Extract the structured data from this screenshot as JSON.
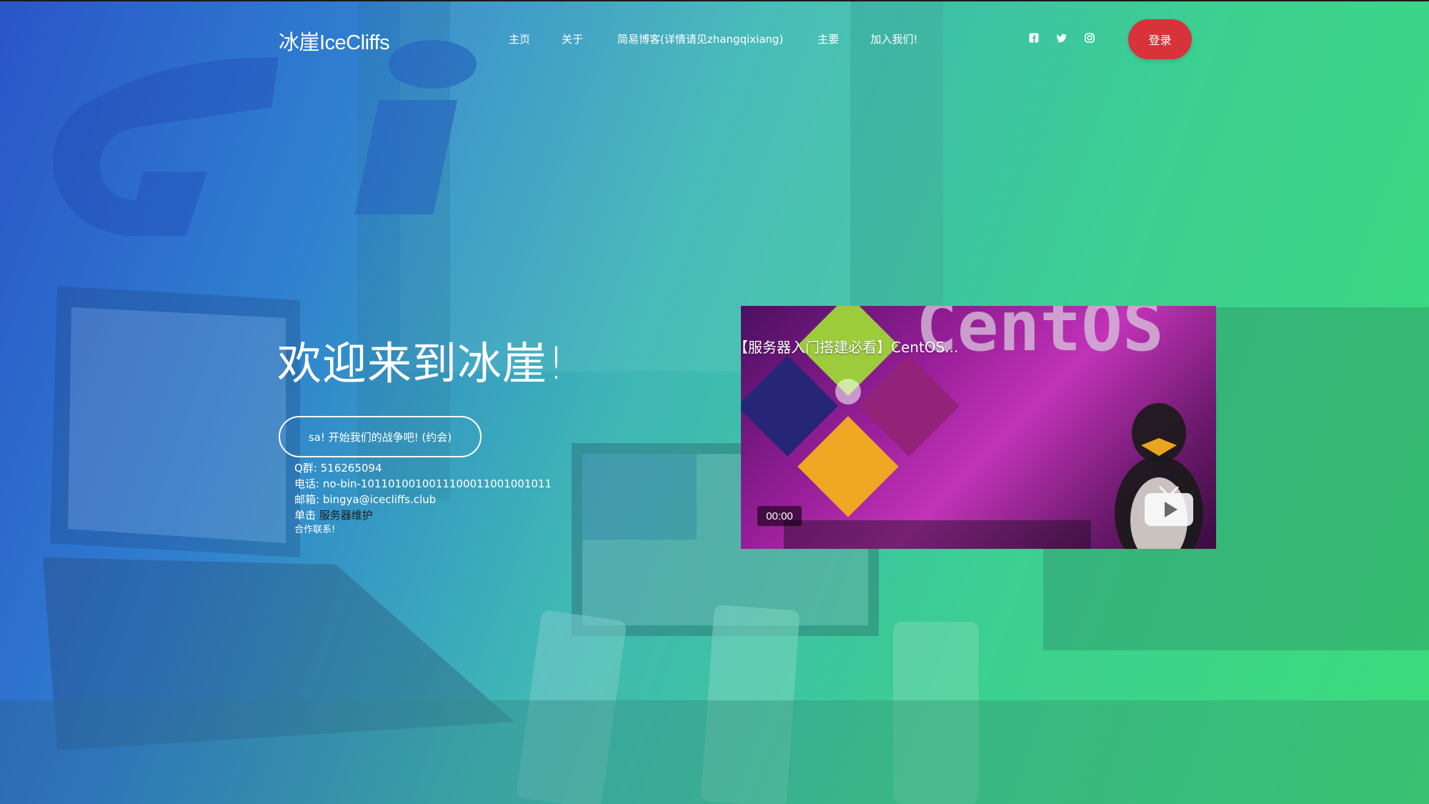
{
  "brand": {
    "name": "冰崖IceCliffs"
  },
  "nav": {
    "items": [
      {
        "label": "主页"
      },
      {
        "label": "关于"
      },
      {
        "label": "简易博客(详情请见zhangqixiang)"
      },
      {
        "label": "主要"
      },
      {
        "label": "加入我们!"
      }
    ],
    "socials": [
      {
        "icon": "facebook-icon"
      },
      {
        "icon": "twitter-icon"
      },
      {
        "icon": "instagram-icon"
      }
    ],
    "login_label": "登录"
  },
  "hero": {
    "title": "欢迎来到冰崖!",
    "cta_label": "sa! 开始我们的战争吧! (约会)",
    "contact": {
      "qq": "Q群: 516265094",
      "phone": "电话: no-bin-1011010010011100011001001011",
      "email": "邮箱: bingya@icecliffs.club",
      "maintenance_prefix": "单击 ",
      "maintenance_link": "服务器维护",
      "cooperation": "合作联系!"
    }
  },
  "video": {
    "title": "【服务器入门搭建必看】CentOS...",
    "time": "00:00",
    "thumbnail_text": "CentOS"
  },
  "colors": {
    "gradient_start": "#2a55c8",
    "gradient_end": "#3bdc7a",
    "login_button": "#d8333b"
  }
}
